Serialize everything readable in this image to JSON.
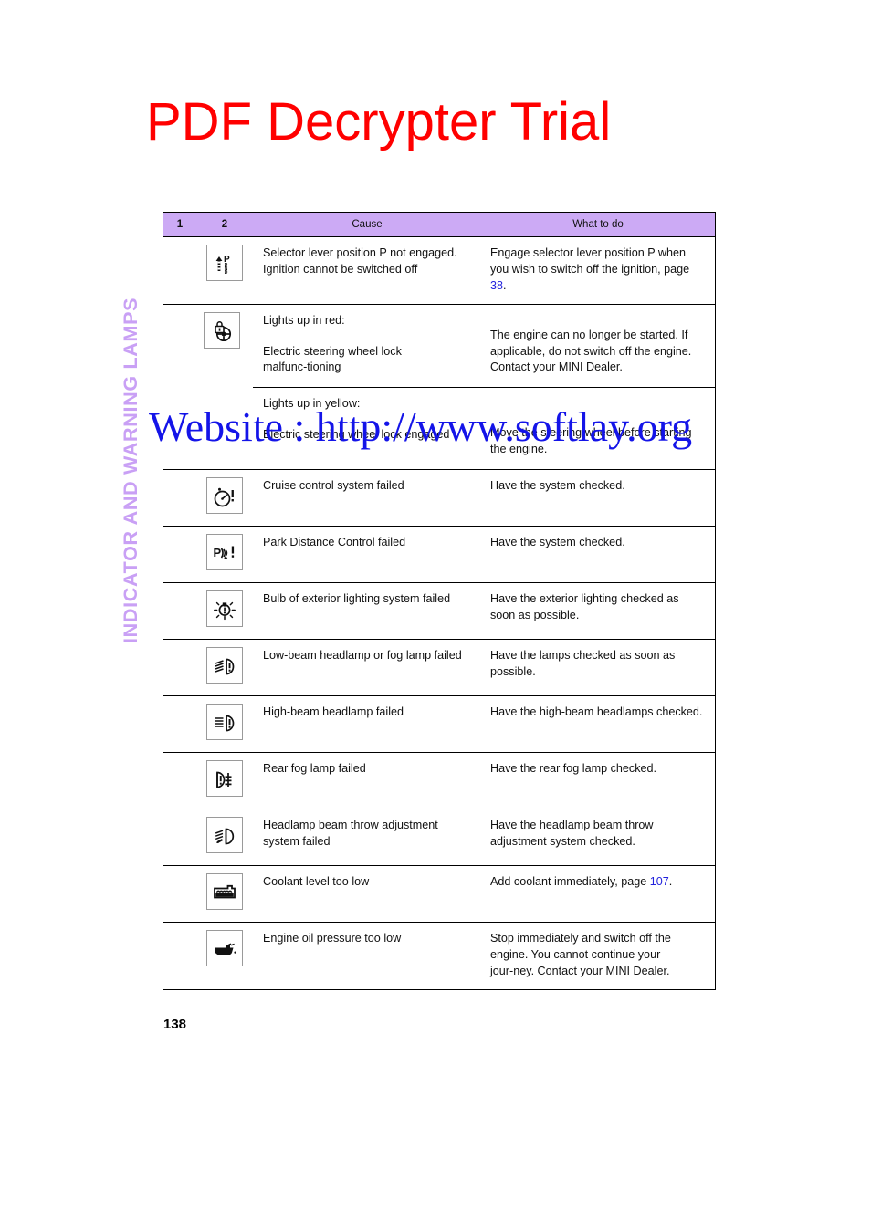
{
  "watermarks": {
    "top": "PDF Decrypter Trial",
    "url": "Website : http://www.softlay.org"
  },
  "chapter_title": "INDICATOR AND WARNING LAMPS",
  "page_number": "138",
  "table": {
    "headers": {
      "col1": "1",
      "col2": "2",
      "cause": "Cause",
      "what_to_do": "What to do"
    },
    "rows": [
      {
        "icon": "selector-lever-p-icon",
        "cause_line1": "Selector lever position P not engaged.",
        "cause_line2": "Ignition cannot be switched off",
        "what_prefix": "Engage selector lever position P when you wish to switch off the ignition, page ",
        "what_link": "38",
        "what_suffix": "."
      },
      {
        "icon": "steering-wheel-lock-icon",
        "upper_label": "Lights up in red:",
        "upper_cause": "Electric steering wheel lock malfunc‑tioning",
        "upper_what": "The engine can no longer be started. If applicable, do not switch off the engine. Contact your MINI Dealer.",
        "lower_label": "Lights up in yellow:",
        "lower_cause": "Electric steering wheel lock engaged",
        "lower_what": "Move the steering wheel before starting the engine."
      },
      {
        "icon": "cruise-control-icon",
        "cause": "Cruise control system failed",
        "what": "Have the system checked."
      },
      {
        "icon": "park-distance-control-icon",
        "cause": "Park Distance Control failed",
        "what": "Have the system checked."
      },
      {
        "icon": "bulb-failure-icon",
        "cause": "Bulb of exterior lighting system failed",
        "what": "Have the exterior lighting checked as soon as possible."
      },
      {
        "icon": "low-beam-failure-icon",
        "cause": "Low-beam headlamp or fog lamp failed",
        "what": "Have the lamps checked as soon as possible."
      },
      {
        "icon": "high-beam-failure-icon",
        "cause": "High-beam headlamp failed",
        "what": "Have the high-beam headlamps checked."
      },
      {
        "icon": "rear-fog-lamp-icon",
        "cause": "Rear fog lamp failed",
        "what": "Have the rear fog lamp checked."
      },
      {
        "icon": "headlamp-beam-throw-icon",
        "cause": "Headlamp beam throw adjustment system failed",
        "what": "Have the headlamp beam throw adjustment system checked."
      },
      {
        "icon": "coolant-level-icon",
        "cause": "Coolant level too low",
        "what_prefix": "Add coolant immediately, page ",
        "what_link": "107",
        "what_suffix": "."
      },
      {
        "icon": "engine-oil-pressure-icon",
        "cause": "Engine oil pressure too low",
        "what": "Stop immediately and switch off the engine. You cannot continue your jour‑ney. Contact your MINI Dealer."
      }
    ]
  },
  "colors": {
    "header_bg": "#ccaaf5",
    "chapter_title": "#c9a0f5",
    "link": "#2222dd",
    "watermark_red": "#ff0000",
    "watermark_blue": "#1414e8"
  }
}
